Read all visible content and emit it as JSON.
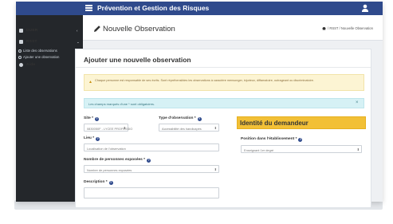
{
  "app": {
    "title": "Prévention et Gestion des Risques"
  },
  "sidebar": {
    "items": [
      {
        "label": "DUER",
        "caret": "‹"
      },
      {
        "label": "RSST",
        "caret": "⌄"
      }
    ],
    "sub_items": [
      {
        "label": "Liste des observations"
      },
      {
        "label": "Ajouter une observation"
      }
    ],
    "aide": {
      "label": "Aide"
    }
  },
  "header": {
    "title": "Nouvelle Observation",
    "breadcrumb": "/ RSST / Nouvelle Observation"
  },
  "card": {
    "title": "Ajouter une nouvelle observation"
  },
  "alerts": {
    "warning": "Chaque personne est responsable de ses écrits. Sont répréhensibles les observations à caractère mensonger, injurieux, diffamatoire, outrageant ou discriminatoire.",
    "info": "Les champs marqués d'une * sont obligatoires.",
    "info_close": "×"
  },
  "form": {
    "site": {
      "label": "Site *",
      "value": "0830050F - LYCEE PROFESSIO"
    },
    "type": {
      "label": "Type d'observation *",
      "value": "Accessibilité des handicapés"
    },
    "lieu": {
      "label": "Lieu *",
      "placeholder": "Localisation de l'observation"
    },
    "nombre": {
      "label": "Nombre de personnes exposées *",
      "placeholder": "Nombre de personnes exposées"
    },
    "description": {
      "label": "Description *"
    }
  },
  "identite": {
    "title": "Identité du demandeur",
    "position_label": "Position dans l'établissement *",
    "position_value": "Enseignant 1er degré"
  },
  "colors": {
    "topbar": "#2f4a8c",
    "sidebar": "#24272b",
    "warning_bg": "#fcf4d3",
    "info_bg": "#d6f1f5",
    "identite_bg": "#f2c036"
  },
  "icons": {
    "menu": "hamburger-icon",
    "user": "user-icon",
    "edit": "pencil-icon",
    "home": "home-icon",
    "help": "question-icon",
    "warning": "warning-icon"
  }
}
